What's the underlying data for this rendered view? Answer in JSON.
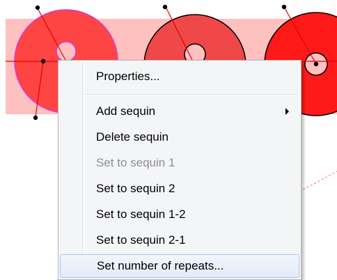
{
  "canvas": {
    "selection_fill": "#ffc0c0",
    "sequin_colors": [
      "#ff4444",
      "#f04848",
      "#ff1a1a"
    ],
    "highlight_stroke": "#d63bd6",
    "guide_line_color": "#e00000",
    "handle_color": "#000000"
  },
  "context_menu": {
    "items": [
      {
        "label": "Properties...",
        "enabled": true
      },
      {
        "label": "Add sequin",
        "enabled": true,
        "has_submenu": true
      },
      {
        "label": "Delete sequin",
        "enabled": true
      },
      {
        "label": "Set to sequin 1",
        "enabled": false
      },
      {
        "label": "Set to sequin 2",
        "enabled": true
      },
      {
        "label": "Set to sequin 1-2",
        "enabled": true
      },
      {
        "label": "Set to sequin 2-1",
        "enabled": true
      },
      {
        "label": "Set number of repeats...",
        "enabled": true,
        "highlighted": true
      }
    ]
  }
}
